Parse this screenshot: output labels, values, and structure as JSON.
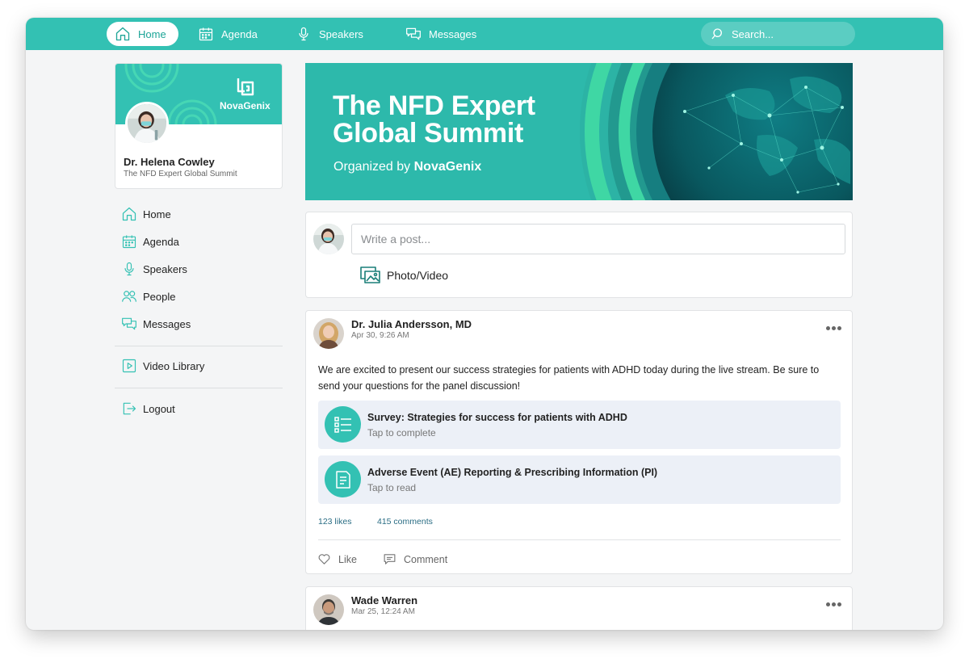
{
  "topnav": {
    "home": "Home",
    "agenda": "Agenda",
    "speakers": "Speakers",
    "messages": "Messages",
    "search_placeholder": "Search..."
  },
  "profile": {
    "brand": "NovaGenix",
    "name": "Dr. Helena Cowley",
    "event": "The NFD Expert Global Summit"
  },
  "sidebar": {
    "items": [
      {
        "label": "Home",
        "icon": "home-icon"
      },
      {
        "label": "Agenda",
        "icon": "calendar-icon"
      },
      {
        "label": "Speakers",
        "icon": "microphone-icon"
      },
      {
        "label": "People",
        "icon": "people-icon"
      },
      {
        "label": "Messages",
        "icon": "messages-icon"
      }
    ],
    "video_library": "Video Library",
    "logout": "Logout"
  },
  "hero": {
    "title_line1": "The NFD Expert",
    "title_line2": "Global Summit",
    "organized_prefix": "Organized by",
    "organizer": "NovaGenix"
  },
  "composer": {
    "placeholder": "Write a post...",
    "photo_label": "Photo/Video"
  },
  "posts": [
    {
      "author": "Dr. Julia Andersson, MD",
      "date": "Apr 30, 9:26 AM",
      "text": "We are excited to present our success strategies for patients with ADHD today during the live stream. Be sure to send your questions for the panel discussion!",
      "attachments": [
        {
          "title": "Survey: Strategies for success for patients with ADHD",
          "subtitle": "Tap to complete",
          "icon": "survey-list-icon"
        },
        {
          "title": "Adverse Event (AE) Reporting & Prescribing Information (PI)",
          "subtitle": "Tap to read",
          "icon": "document-icon"
        }
      ],
      "likes": "123 likes",
      "comments": "415 comments",
      "like_label": "Like",
      "comment_label": "Comment"
    },
    {
      "author": "Wade Warren",
      "date": "Mar 25, 12:24 AM"
    }
  ],
  "colors": {
    "accent": "#33c1b3",
    "accent_dark": "#1da597",
    "link": "#2a6d84",
    "attachment_bg": "#ecf0f7"
  }
}
